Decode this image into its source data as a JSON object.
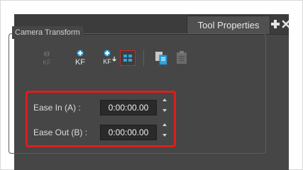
{
  "window": {
    "tab_label": "Tool Properties",
    "add_icon": "plus-icon",
    "close_icon": "close-x-icon"
  },
  "camera_transform": {
    "group_title": "Camera Transform",
    "toolbar": [
      {
        "icon": "delete-keyframe-icon",
        "label": "KF",
        "enabled": false
      },
      {
        "icon": "add-keyframe-icon",
        "label": "KF",
        "enabled": true
      },
      {
        "icon": "add-keyframe-next-icon",
        "label": "KF",
        "enabled": true
      },
      {
        "icon": "selected-mode-icon",
        "label": "",
        "enabled": true,
        "selected": true
      },
      {
        "icon": "copy-icon",
        "label": "",
        "enabled": true
      },
      {
        "icon": "paste-icon",
        "label": "",
        "enabled": false
      }
    ],
    "ease_in": {
      "label": "Ease In (A) :",
      "value": "0:00:00.00"
    },
    "ease_out": {
      "label": "Ease Out (B) :",
      "value": "0:00:00.00"
    }
  },
  "colors": {
    "panel_bg": "#464646",
    "accent_blue": "#2fa6e0",
    "highlight_red": "#e01c1c"
  }
}
